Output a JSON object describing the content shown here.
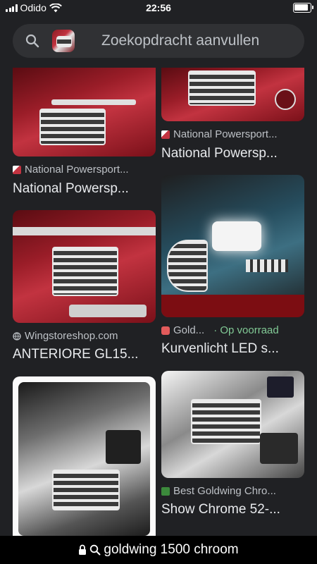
{
  "status": {
    "carrier": "Odido",
    "time": "22:56",
    "battery_level": 0.9
  },
  "search": {
    "placeholder": "Zoekopdracht aanvullen"
  },
  "results": [
    {
      "source": "National Powersport...",
      "title": "National Powersp..."
    },
    {
      "source": "National Powersport...",
      "title": "National Powersp..."
    },
    {
      "source": "Wingstoreshop.com",
      "title": "ANTERIORE GL15..."
    },
    {
      "source": "Gold...",
      "stock": "· Op voorraad",
      "title": "Kurvenlicht LED s..."
    },
    {
      "source": "Best Goldwing Chro...",
      "title": "Show Chrome 52-..."
    }
  ],
  "url": {
    "text": "goldwing 1500 chroom"
  },
  "colors": {
    "background": "#202124",
    "stock_green": "#81c995"
  }
}
